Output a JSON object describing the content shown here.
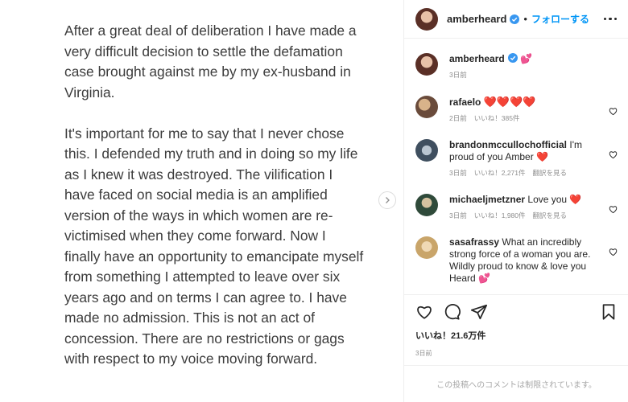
{
  "post": {
    "paragraphs": [
      "After a great deal of deliberation I have made a very difficult decision to settle the defamation case brought against me by my ex-husband in Virginia.",
      "It's important for me to say that I never chose this. I defended my truth and in doing so my life as I knew it was destroyed. The vilification I have faced on social media is an amplified version of the ways in which women are re-victimised when they come forward.  Now I finally have an opportunity to emancipate myself from something I attempted to leave over six years ago and on terms I can agree to. I have made no admission. This is not an act of concession. There are no restrictions or gags with respect to my voice moving forward."
    ]
  },
  "header": {
    "username": "amberheard",
    "separator": "•",
    "follow_label": "フォローする"
  },
  "caption": {
    "username": "amberheard",
    "text": "💕",
    "time": "3日前"
  },
  "comments": [
    {
      "username": "rafaelo",
      "text": "❤️❤️❤️❤️",
      "time": "2日前",
      "likes": "いいね！385件",
      "translate": ""
    },
    {
      "username": "brandonmccullochofficial",
      "text": "I'm proud of you Amber ❤️",
      "time": "3日前",
      "likes": "いいね！2,271件",
      "translate": "翻訳を見る"
    },
    {
      "username": "michaeljmetzner",
      "text": "Love you ❤️",
      "time": "3日前",
      "likes": "いいね！1,980件",
      "translate": "翻訳を見る"
    },
    {
      "username": "sasafrassy",
      "text": "What an incredibly strong force of a woman you are. Wildly proud to know & love you Heard 💕",
      "time": "",
      "likes": "",
      "translate": ""
    }
  ],
  "footer": {
    "likes": "いいね！21.6万件",
    "time": "3日前",
    "restricted_notice": "この投稿へのコメントは制限されています。"
  },
  "icons": {
    "verified": "verified-badge-icon",
    "more": "more-options-icon",
    "like": "heart-icon",
    "comment": "comment-icon",
    "share": "paper-plane-icon",
    "save": "bookmark-icon",
    "next": "chevron-right-icon"
  },
  "colors": {
    "accent": "#0095f6",
    "heart": "#ed4956",
    "muted": "#8e8e8e"
  }
}
